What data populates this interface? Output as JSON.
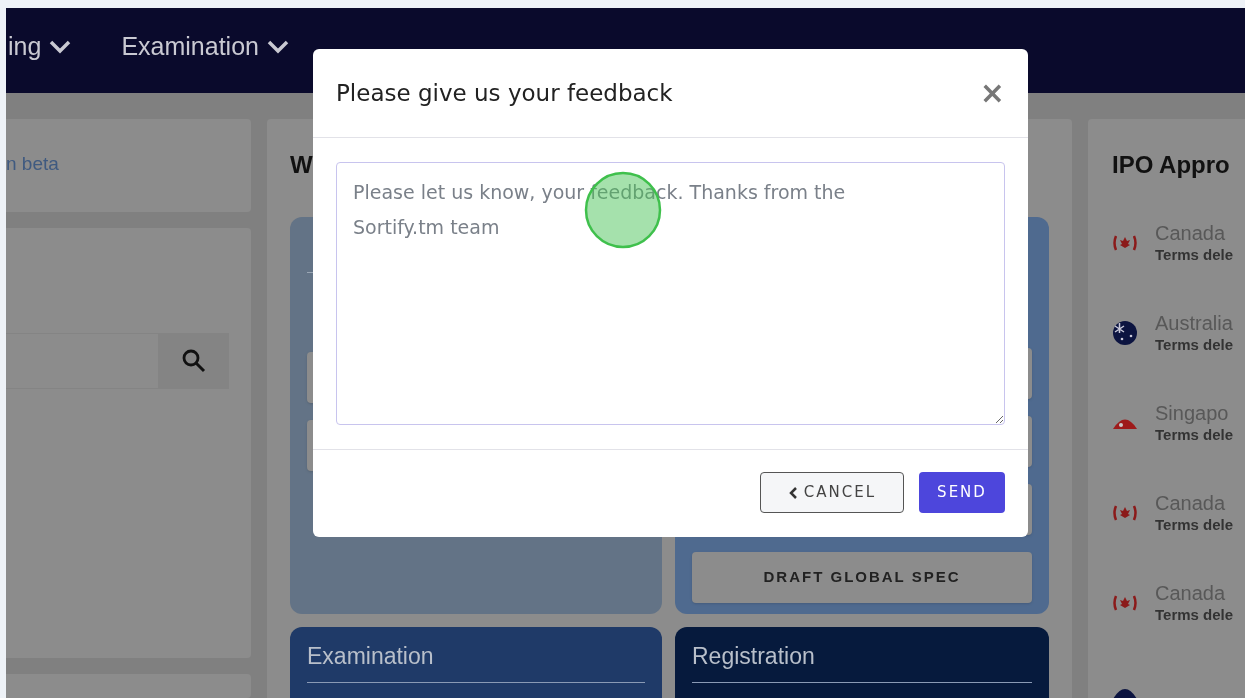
{
  "nav": [
    {
      "label": "ing"
    },
    {
      "label": "Examination"
    }
  ],
  "left": {
    "link": "n beta"
  },
  "middle": {
    "title": "W",
    "cards": [
      {
        "kind": "light"
      },
      {
        "kind": "medium",
        "button": "DRAFT GLOBAL SPEC"
      }
    ],
    "bottom_cards": [
      {
        "kind": "examination",
        "title": "Examination"
      },
      {
        "kind": "registration",
        "title": "Registration"
      }
    ]
  },
  "right": {
    "title": "IPO Appro",
    "items": [
      {
        "kind": "canada",
        "name": "Canada",
        "sub": "Terms dele"
      },
      {
        "kind": "australia",
        "name": "Australia",
        "sub": "Terms dele"
      },
      {
        "kind": "singapore",
        "name": "Singapo",
        "sub": "Terms dele"
      },
      {
        "kind": "canada",
        "name": "Canada",
        "sub": "Terms dele"
      },
      {
        "kind": "canada",
        "name": "Canada",
        "sub": "Terms dele"
      },
      {
        "kind": "us"
      }
    ]
  },
  "modal": {
    "title": "Please give us your feedback",
    "close": "×",
    "placeholder": "Please let us know, your feedback. Thanks from the Sortify.tm team",
    "cancel": "CANCEL",
    "send": "SEND"
  }
}
